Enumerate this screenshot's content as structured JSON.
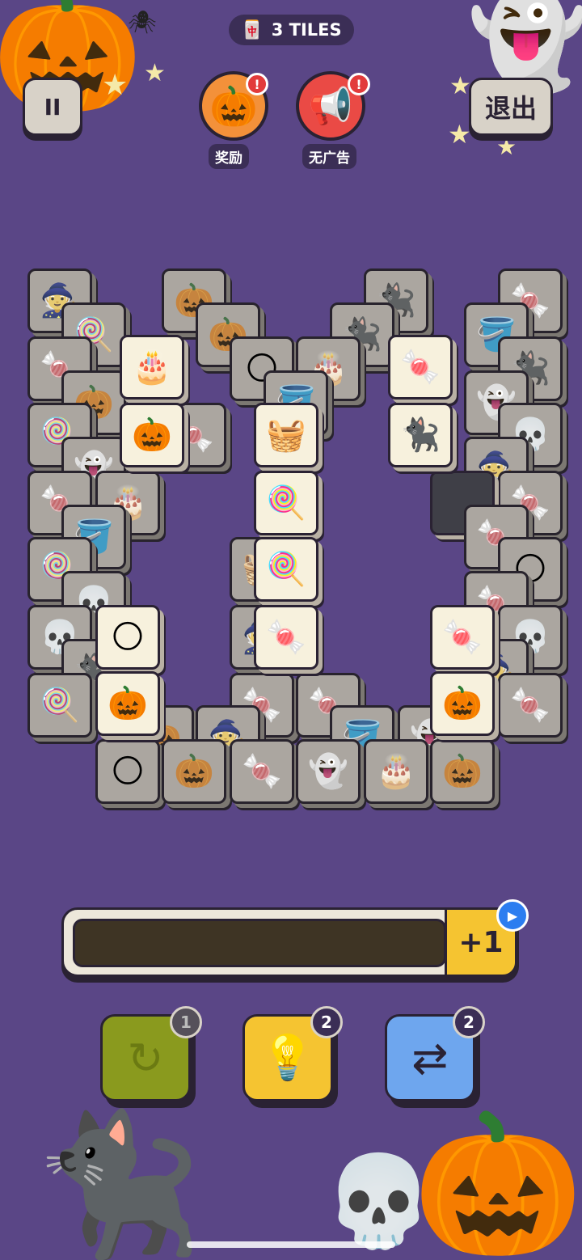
{
  "hud": {
    "tiles_counter": "3 TILES",
    "pause_label": "II",
    "exit_label": "退出",
    "reward_label": "奖励",
    "no_ads_label": "无广告",
    "alert_glyph": "!"
  },
  "icons": {
    "tiles": "🀄",
    "reward": "🎃",
    "no_ads": "📢"
  },
  "board": {
    "tile_symbols": {
      "cake": "🎂",
      "pumpkin": "🎃",
      "candy": "🍬",
      "cat": "🐈‍⬛",
      "basket": "🧺",
      "lollipop": "🍭",
      "candy_cane": "🍭",
      "wrapped_candy": "🍬",
      "moon": "🌕",
      "pumpkin_bag": "🎃",
      "skull": "💀",
      "ghost": "👻",
      "cauldron": "🪣",
      "witch_hat": "🧙"
    }
  },
  "slot_bar": {
    "plus_one_label": "+1",
    "play_glyph": "▶"
  },
  "powerups": {
    "undo": {
      "icon": "↻",
      "count": "1"
    },
    "hint": {
      "icon": "💡",
      "count": "2"
    },
    "shuffle": {
      "icon": "⇄",
      "count": "2"
    }
  },
  "decor": {
    "pumpkin_top_left": "🎃",
    "ghost_top_right": "👻",
    "star": "★",
    "spider": "🕷",
    "cat_bottom": "🐈‍⬛",
    "pumpkin_bottom": "🎃",
    "skull_bottom": "💀"
  },
  "colors": {
    "background": "#5a4686",
    "hint_yellow": "#f5c431",
    "shuffle_blue": "#6ea6ee",
    "undo_green": "#8a9a1e",
    "alert_red": "#e23b3b"
  }
}
